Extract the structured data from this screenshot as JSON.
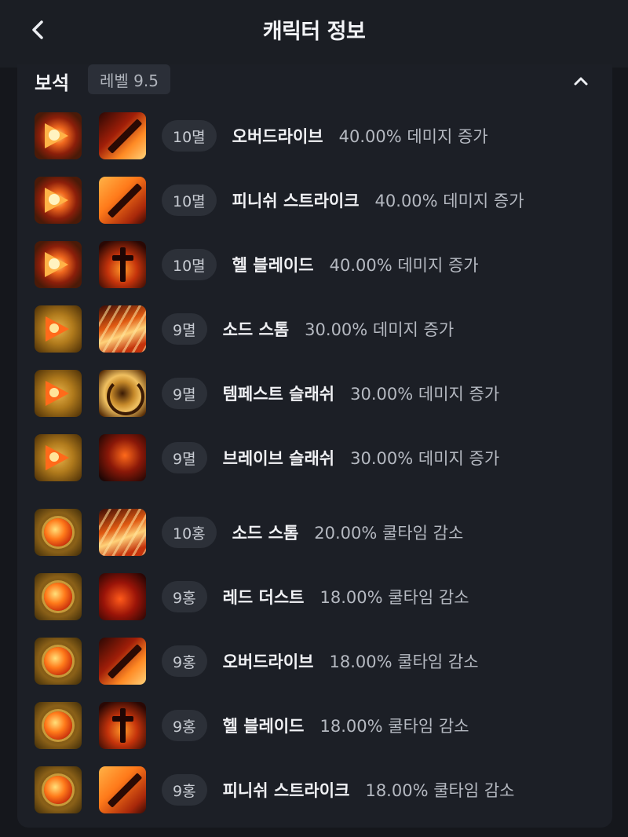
{
  "header": {
    "title": "캐릭터 정보"
  },
  "section": {
    "title": "보석",
    "level": "레벨 9.5"
  },
  "rows": [
    {
      "gem": "red",
      "skill_icon": "overdrive",
      "grade": "10멸",
      "skill": "오버드라이브",
      "effect": "40.00% 데미지 증가"
    },
    {
      "gem": "red",
      "skill_icon": "finish-strike",
      "grade": "10멸",
      "skill": "피니쉬 스트라이크",
      "effect": "40.00% 데미지 증가"
    },
    {
      "gem": "red",
      "skill_icon": "hell-blade",
      "grade": "10멸",
      "skill": "헬 블레이드",
      "effect": "40.00% 데미지 증가"
    },
    {
      "gem": "gold",
      "skill_icon": "sword-storm",
      "grade": "9멸",
      "skill": "소드 스톰",
      "effect": "30.00% 데미지 증가"
    },
    {
      "gem": "gold",
      "skill_icon": "tempest-slash",
      "grade": "9멸",
      "skill": "템페스트 슬래쉬",
      "effect": "30.00% 데미지 증가"
    },
    {
      "gem": "gold",
      "skill_icon": "brave-slash",
      "grade": "9멸",
      "skill": "브레이브 슬래쉬",
      "effect": "30.00% 데미지 증가"
    },
    {
      "gem": "orb",
      "skill_icon": "sword-storm",
      "grade": "10홍",
      "skill": "소드 스톰",
      "effect": "20.00% 쿨타임 감소"
    },
    {
      "gem": "orb",
      "skill_icon": "red-dust",
      "grade": "9홍",
      "skill": "레드 더스트",
      "effect": "18.00% 쿨타임 감소"
    },
    {
      "gem": "orb",
      "skill_icon": "overdrive",
      "grade": "9홍",
      "skill": "오버드라이브",
      "effect": "18.00% 쿨타임 감소"
    },
    {
      "gem": "orb",
      "skill_icon": "hell-blade",
      "grade": "9홍",
      "skill": "헬 블레이드",
      "effect": "18.00% 쿨타임 감소"
    },
    {
      "gem": "orb",
      "skill_icon": "finish-strike",
      "grade": "9홍",
      "skill": "피니쉬 스트라이크",
      "effect": "18.00% 쿨타임 감소"
    }
  ]
}
